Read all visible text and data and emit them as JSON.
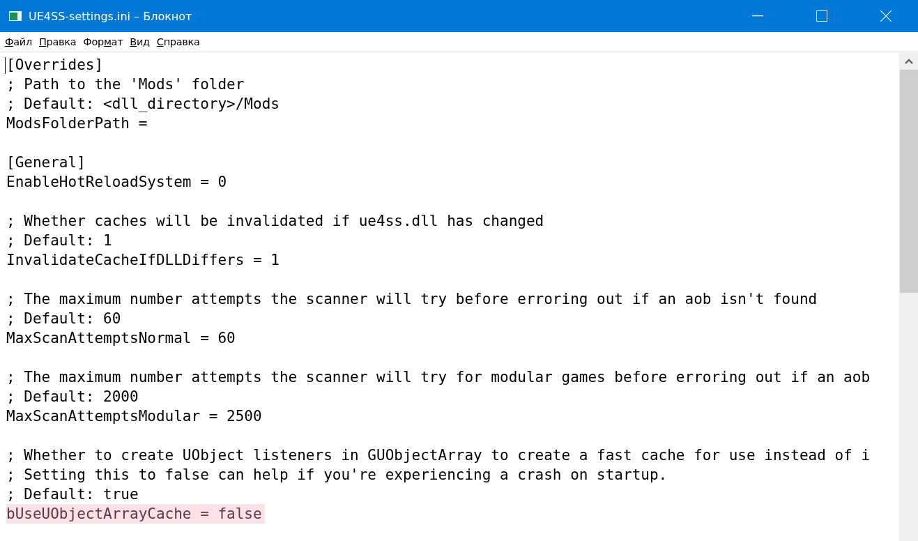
{
  "window": {
    "title": "UE4SS-settings.ini – Блокнот"
  },
  "menu": [
    {
      "key": "Ф",
      "post": "айл"
    },
    {
      "key": "П",
      "post": "равка"
    },
    {
      "pre": "Фор",
      "key": "м",
      "post": "ат"
    },
    {
      "key": "В",
      "post": "ид"
    },
    {
      "key": "С",
      "post": "правка"
    }
  ],
  "lines": [
    {
      "kind": "text",
      "text": "[Overrides]",
      "highlighted": false
    },
    {
      "kind": "text",
      "text": "; Path to the 'Mods' folder",
      "highlighted": false
    },
    {
      "kind": "text",
      "text": "; Default: <dll_directory>/Mods",
      "highlighted": false
    },
    {
      "kind": "text",
      "text": "ModsFolderPath =",
      "highlighted": false
    },
    {
      "kind": "blank"
    },
    {
      "kind": "text",
      "text": "[General]",
      "highlighted": false
    },
    {
      "kind": "text",
      "text": "EnableHotReloadSystem = 0",
      "highlighted": false
    },
    {
      "kind": "blank"
    },
    {
      "kind": "text",
      "text": "; Whether caches will be invalidated if ue4ss.dll has changed",
      "highlighted": false
    },
    {
      "kind": "text",
      "text": "; Default: 1",
      "highlighted": false
    },
    {
      "kind": "text",
      "text": "InvalidateCacheIfDLLDiffers = 1",
      "highlighted": false
    },
    {
      "kind": "blank"
    },
    {
      "kind": "text",
      "text": "; The maximum number attempts the scanner will try before erroring out if an aob isn't found",
      "highlighted": false
    },
    {
      "kind": "text",
      "text": "; Default: 60",
      "highlighted": false
    },
    {
      "kind": "text",
      "text": "MaxScanAttemptsNormal = 60",
      "highlighted": false
    },
    {
      "kind": "blank"
    },
    {
      "kind": "text",
      "text": "; The maximum number attempts the scanner will try for modular games before erroring out if an aob",
      "highlighted": false
    },
    {
      "kind": "text",
      "text": "; Default: 2000",
      "highlighted": false
    },
    {
      "kind": "text",
      "text": "MaxScanAttemptsModular = 2500",
      "highlighted": false
    },
    {
      "kind": "blank"
    },
    {
      "kind": "text",
      "text": "; Whether to create UObject listeners in GUObjectArray to create a fast cache for use instead of i",
      "highlighted": false
    },
    {
      "kind": "text",
      "text": "; Setting this to false can help if you're experiencing a crash on startup.",
      "highlighted": false
    },
    {
      "kind": "text",
      "text": "; Default: true",
      "highlighted": false
    },
    {
      "kind": "text",
      "text": "bUseUObjectArrayCache = false",
      "highlighted": true
    }
  ]
}
